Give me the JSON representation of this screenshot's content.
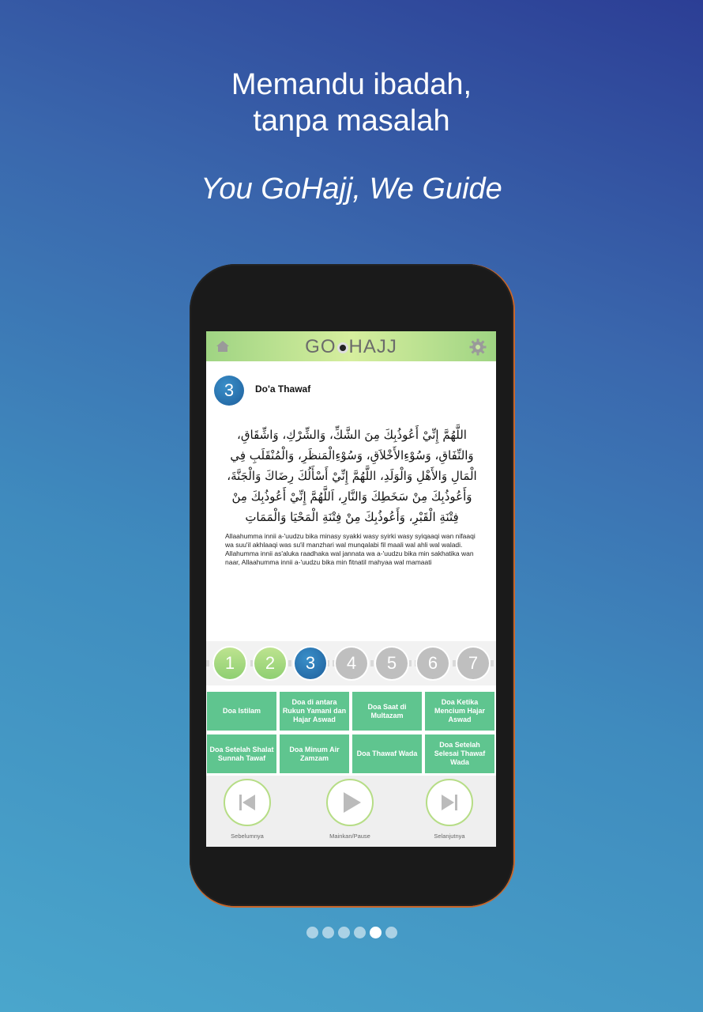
{
  "headline": {
    "line1": "Memandu ibadah,",
    "line2": "tanpa masalah"
  },
  "tagline": "You GoHajj, We Guide",
  "app": {
    "logo_left": "GO",
    "logo_right": "HAJJ",
    "step_number": "3",
    "step_title": "Do'a Thawaf",
    "arabic_text": "اللَّهُمَّ إِنِّيْ أَعُوذُبِكَ مِنَ الشَّكِّ، وَالشِّرْكِ، وَاشِّقَاقِ، وَالنِّفَاقِ، وَسُوْءِالأَخْلاَقِ، وَسُوْءِالْمَنظَرِ، وَالْمُنْقَلَبِ فِي الْمَالِ وَالأَهْلِ وَالْوَلَدِ، اللَّهُمَّ إِنِّيْ أَسْأَلُكَ رِضَاكَ وَالْجَنَّةَ، وَأَعُوذُبِكَ مِنْ سَخَطِكَ وَالنَّارِ، اَللَّهُمَّ إِنِّيْ أَعُوذُبِكَ مِنْ فِتْنَةِ الْقَبْرِ، وَأَعُوذُبِكَ مِنْ فِتْنَةِ الْمَحْيَا وَالْمَمَاتِ",
    "latin_text": "Allaahumma innii a-'uudzu bika minasy syakki wasy syirki wasy syiqaaqi wan nifaaqi wa suu'il akhlaaqi was su'il manzhari wal munqalabi fil maali wal ahli wal waladi. Allahumma innii as'aluka raadhaka wal jannata wa a-'uudzu bika min sakhatika wan naar, Allaahumma innii a-'uudzu bika min fitnatil mahyaa wal mamaati",
    "steps": [
      "1",
      "2",
      "3",
      "4",
      "5",
      "6",
      "7"
    ],
    "current_step": 3,
    "doa_buttons": [
      "Doa Istilam",
      "Doa di antara Rukun Yamani dan Hajar Aswad",
      "Doa Saat di Multazam",
      "Doa Ketika Mencium Hajar Aswad",
      "Doa Setelah Shalat Sunnah Tawaf",
      "Doa Minum Air Zamzam",
      "Doa Thawaf Wada",
      "Doa Setelah Selesai Thawaf Wada"
    ],
    "controls": {
      "prev": "Sebelumnya",
      "play": "Mainkan/Pause",
      "next": "Selanjutnya"
    }
  },
  "pager": {
    "total": 6,
    "active": 5
  },
  "colors": {
    "accent_green": "#5fc58f",
    "step_blue": "#1e5f9c",
    "bar_green": "#9fd483"
  }
}
